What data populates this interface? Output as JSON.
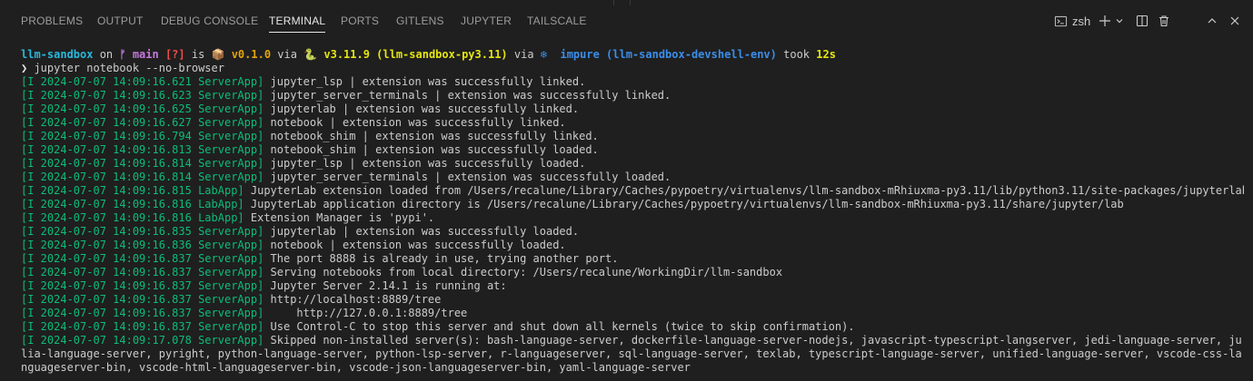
{
  "panel": {
    "tabs": [
      {
        "label": "PROBLEMS"
      },
      {
        "label": "OUTPUT"
      },
      {
        "label": "DEBUG CONSOLE"
      },
      {
        "label": "TERMINAL"
      },
      {
        "label": "PORTS"
      },
      {
        "label": "GITLENS"
      },
      {
        "label": "JUPYTER"
      },
      {
        "label": "TAILSCALE"
      }
    ],
    "active_tab": "TERMINAL",
    "shell_label": "zsh",
    "actions": [
      "terminal-icon",
      "plus-icon",
      "chevron-down-icon",
      "split-icon",
      "trash-icon",
      "chevron-up-icon",
      "close-icon"
    ]
  },
  "prompt": {
    "dir": "llm-sandbox",
    "on": " on ",
    "branch_icon": "ᚠ",
    "branch": " main",
    "status": " [?]",
    "is": " is ",
    "pkg_icon": "📦",
    "version": " v0.1.0",
    "via1": " via ",
    "py_icon": "🐍",
    "python": " v3.11.9 (llm-sandbox-py3.11)",
    "via2": " via ",
    "nix_icon": "❄",
    "nix": "  impure (llm-sandbox-devshell-env)",
    "took": " took ",
    "duration": "12s",
    "arrow": "❯",
    "command": " jupyter notebook --no-browser"
  },
  "log": [
    {
      "tag": "[I 2024-07-07 14:09:16.621 ServerApp]",
      "msg": " jupyter_lsp | extension was successfully linked."
    },
    {
      "tag": "[I 2024-07-07 14:09:16.623 ServerApp]",
      "msg": " jupyter_server_terminals | extension was successfully linked."
    },
    {
      "tag": "[I 2024-07-07 14:09:16.625 ServerApp]",
      "msg": " jupyterlab | extension was successfully linked."
    },
    {
      "tag": "[I 2024-07-07 14:09:16.627 ServerApp]",
      "msg": " notebook | extension was successfully linked."
    },
    {
      "tag": "[I 2024-07-07 14:09:16.794 ServerApp]",
      "msg": " notebook_shim | extension was successfully linked."
    },
    {
      "tag": "[I 2024-07-07 14:09:16.813 ServerApp]",
      "msg": " notebook_shim | extension was successfully loaded."
    },
    {
      "tag": "[I 2024-07-07 14:09:16.814 ServerApp]",
      "msg": " jupyter_lsp | extension was successfully loaded."
    },
    {
      "tag": "[I 2024-07-07 14:09:16.814 ServerApp]",
      "msg": " jupyter_server_terminals | extension was successfully loaded."
    },
    {
      "tag": "[I 2024-07-07 14:09:16.815 LabApp]",
      "msg": " JupyterLab extension loaded from /Users/recalune/Library/Caches/pypoetry/virtualenvs/llm-sandbox-mRhiuxma-py3.11/lib/python3.11/site-packages/jupyterlab"
    },
    {
      "tag": "[I 2024-07-07 14:09:16.816 LabApp]",
      "msg": " JupyterLab application directory is /Users/recalune/Library/Caches/pypoetry/virtualenvs/llm-sandbox-mRhiuxma-py3.11/share/jupyter/lab"
    },
    {
      "tag": "[I 2024-07-07 14:09:16.816 LabApp]",
      "msg": " Extension Manager is 'pypi'."
    },
    {
      "tag": "[I 2024-07-07 14:09:16.835 ServerApp]",
      "msg": " jupyterlab | extension was successfully loaded."
    },
    {
      "tag": "[I 2024-07-07 14:09:16.836 ServerApp]",
      "msg": " notebook | extension was successfully loaded."
    },
    {
      "tag": "[I 2024-07-07 14:09:16.837 ServerApp]",
      "msg": " The port 8888 is already in use, trying another port."
    },
    {
      "tag": "[I 2024-07-07 14:09:16.837 ServerApp]",
      "msg": " Serving notebooks from local directory: /Users/recalune/WorkingDir/llm-sandbox"
    },
    {
      "tag": "[I 2024-07-07 14:09:16.837 ServerApp]",
      "msg": " Jupyter Server 2.14.1 is running at:"
    },
    {
      "tag": "[I 2024-07-07 14:09:16.837 ServerApp]",
      "msg": " http://localhost:8889/tree"
    },
    {
      "tag": "[I 2024-07-07 14:09:16.837 ServerApp]",
      "msg": "     http://127.0.0.1:8889/tree"
    },
    {
      "tag": "[I 2024-07-07 14:09:16.837 ServerApp]",
      "msg": " Use Control-C to stop this server and shut down all kernels (twice to skip confirmation)."
    }
  ],
  "log_skipped": {
    "tag": "[I 2024-07-07 14:09:17.078 ServerApp]",
    "msg": " Skipped non-installed server(s): bash-language-server, dockerfile-language-server-nodejs, javascript-typescript-langserver, jedi-language-server, julia-language-server, pyright, python-language-server, python-lsp-server, r-languageserver, sql-language-server, texlab, typescript-language-server, unified-language-server, vscode-css-languageserver-bin, vscode-html-languageserver-bin, vscode-json-languageserver-bin, yaml-language-server"
  },
  "colors": {
    "background": "#1f1f1f",
    "log_tag": "#0dbc79",
    "prompt_dir": "#29b8db",
    "branch": "#c678dd",
    "status": "#f14c4c",
    "version": "#e5a50a",
    "python": "#e5e510",
    "nix": "#3b8eea"
  }
}
